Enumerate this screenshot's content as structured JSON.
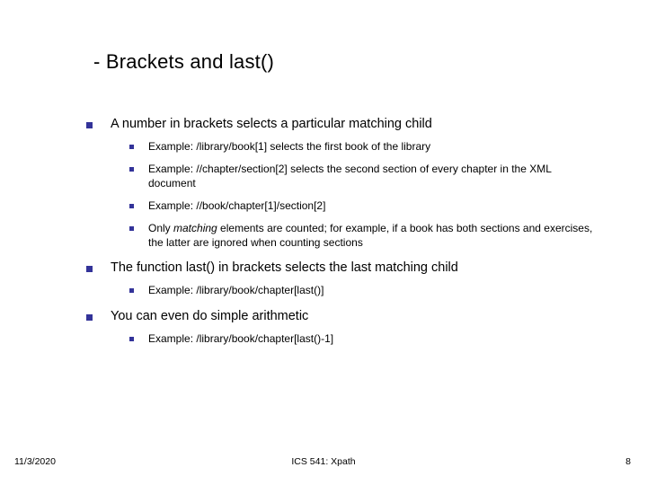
{
  "title": "- Brackets and last()",
  "bullets": [
    {
      "text": "A number in brackets selects a particular matching child",
      "sub": [
        "Example: /library/book[1] selects the first book of the library",
        "Example: //chapter/section[2] selects the second section of every chapter in the XML document",
        "Example: //book/chapter[1]/section[2]",
        "Only <span class=\"em\">matching</span> elements are counted; for example, if a book has both sections and exercises, the latter are ignored when counting sections"
      ]
    },
    {
      "text": "The function last() in brackets selects the last matching child",
      "sub": [
        "Example: /library/book/chapter[last()]"
      ]
    },
    {
      "text": "You can even do simple arithmetic",
      "sub": [
        "Example: /library/book/chapter[last()-1]"
      ]
    }
  ],
  "footer": {
    "date": "11/3/2020",
    "course": "ICS 541: Xpath",
    "page": "8"
  }
}
